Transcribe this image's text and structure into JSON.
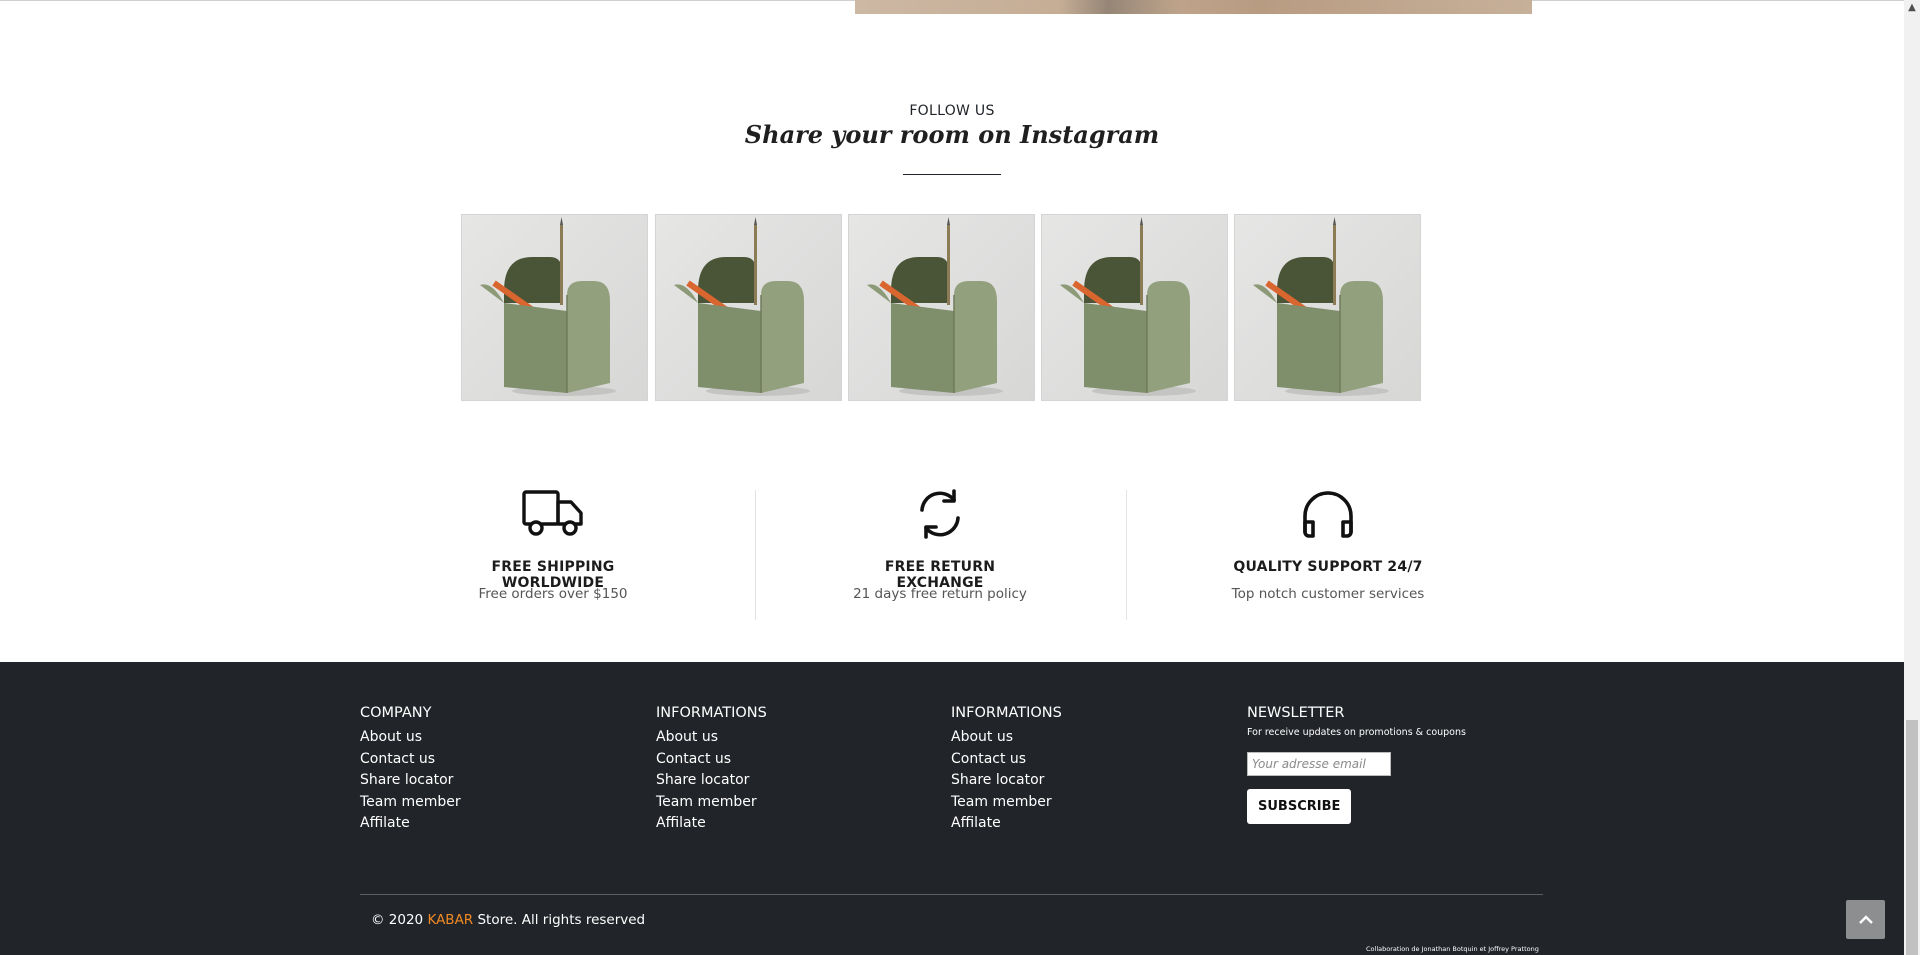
{
  "follow": {
    "kicker": "FOLLOW US",
    "title": "Share your room on Instagram"
  },
  "instagram": {
    "images": [
      {
        "icon": "pencil-holder-photo"
      },
      {
        "icon": "pencil-holder-photo"
      },
      {
        "icon": "pencil-holder-photo"
      },
      {
        "icon": "pencil-holder-photo"
      },
      {
        "icon": "pencil-holder-photo"
      }
    ]
  },
  "features": [
    {
      "icon": "truck-icon",
      "title": "FREE SHIPPING WORLDWIDE",
      "subtitle": "Free orders over $150"
    },
    {
      "icon": "refresh-icon",
      "title": "FREE RETURN EXCHANGE",
      "subtitle": "21 days free return policy"
    },
    {
      "icon": "headphones-icon",
      "title": "QUALITY SUPPORT 24/7",
      "subtitle": "Top notch customer services"
    }
  ],
  "footer": {
    "columns": [
      {
        "heading": "COMPANY",
        "links": [
          "About us",
          "Contact us",
          "Share locator",
          "Team member",
          "Affilate"
        ]
      },
      {
        "heading": "INFORMATIONS",
        "links": [
          "About us",
          "Contact us",
          "Share locator",
          "Team member",
          "Affilate"
        ]
      },
      {
        "heading": "INFORMATIONS",
        "links": [
          "About us",
          "Contact us",
          "Share locator",
          "Team member",
          "Affilate"
        ]
      }
    ],
    "newsletter": {
      "heading": "NEWSLETTER",
      "description": "For receive updates on promotions & coupons",
      "placeholder": "Your adresse email",
      "button": "SUBSCRIBE"
    },
    "copyright": {
      "prefix": "© 2020 ",
      "brand": "KABAR",
      "suffix": " Store. All rights reserved"
    },
    "credit": "Collaboration de Jonathan Botquin et Joffrey Prattong",
    "back_to_top_icon": "chevron-up-icon"
  },
  "colors": {
    "footer_bg": "#212429",
    "brand_accent": "#f08a24",
    "holder_green": "#7f8e6b",
    "pencil_orange": "#d9652f"
  }
}
